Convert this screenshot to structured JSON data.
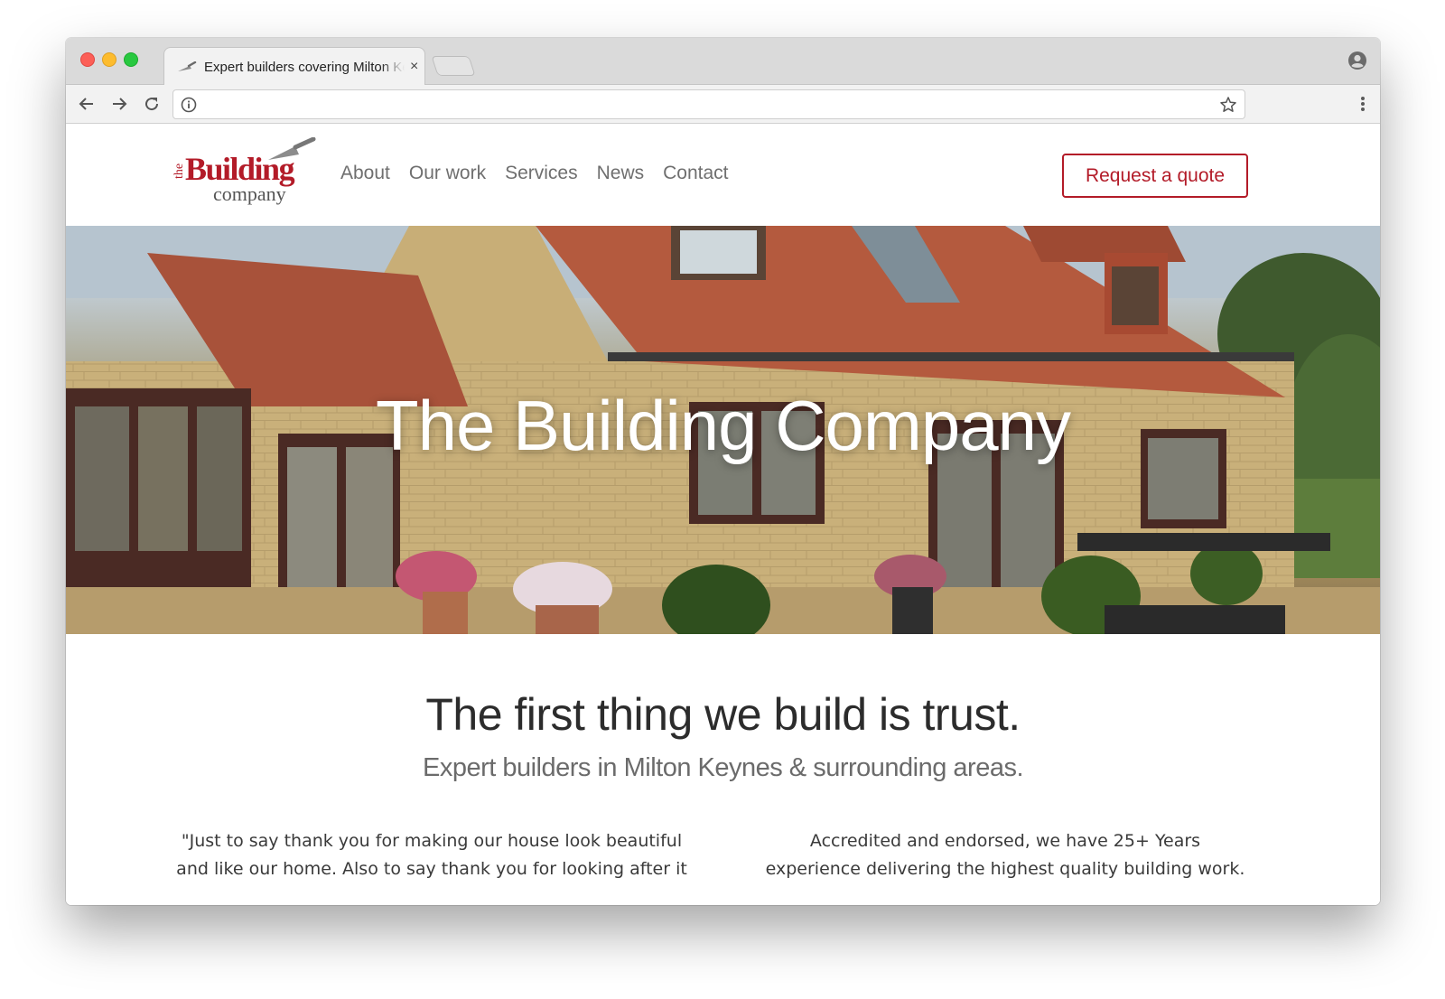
{
  "browser": {
    "tab_title": "Expert builders covering Milton Keynes",
    "tab_close": "×",
    "url": ""
  },
  "site": {
    "logo": {
      "the": "the",
      "building": "Building",
      "company": "company"
    },
    "nav": [
      {
        "label": "About"
      },
      {
        "label": "Our work"
      },
      {
        "label": "Services"
      },
      {
        "label": "News"
      },
      {
        "label": "Contact"
      }
    ],
    "cta_label": "Request a quote",
    "hero_title": "The Building Company",
    "intro_title": "The first thing we build is trust.",
    "intro_subtitle": "Expert builders in Milton Keynes & surrounding areas.",
    "testimonial_lines": [
      "\"Just to say thank you for making our house look beautiful",
      "and like our home. Also to say thank you for looking after it"
    ],
    "accreditation_lines": [
      "Accredited and endorsed, we have 25+ Years",
      "experience delivering the highest quality building work."
    ]
  },
  "colors": {
    "brand_red": "#b31b28",
    "nav_text": "#6f6f6f",
    "heading": "#2c2c2c"
  },
  "icons": [
    "back-icon",
    "forward-icon",
    "reload-icon",
    "info-icon",
    "star-icon",
    "menu-icon",
    "profile-icon",
    "favicon-trowel-icon",
    "trowel-icon"
  ]
}
